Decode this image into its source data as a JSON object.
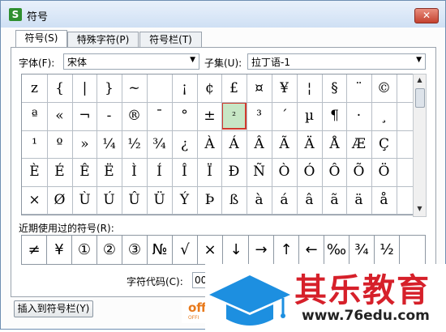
{
  "window": {
    "icon_letter": "S",
    "title": "符号",
    "close_glyph": "✕"
  },
  "tabs": [
    {
      "label": "符号(S)"
    },
    {
      "label": "特殊字符(P)"
    },
    {
      "label": "符号栏(T)"
    }
  ],
  "font": {
    "label": "字体(F):",
    "value": "宋体"
  },
  "subset": {
    "label": "子集(U):",
    "value": "拉丁语-1"
  },
  "symbols": [
    [
      "z",
      "{",
      "|",
      "}",
      "~",
      " ",
      "¡",
      "¢",
      "£",
      "¤",
      "¥",
      "¦",
      "§",
      "¨",
      "©"
    ],
    [
      "ª",
      "«",
      "¬",
      "-",
      "®",
      "¯",
      "°",
      "±",
      "²",
      "³",
      "´",
      "µ",
      "¶",
      "·",
      "¸"
    ],
    [
      "¹",
      "º",
      "»",
      "¼",
      "½",
      "¾",
      "¿",
      "À",
      "Á",
      "Â",
      "Ã",
      "Ä",
      "Å",
      "Æ",
      "Ç"
    ],
    [
      "È",
      "É",
      "Ê",
      "Ë",
      "Ì",
      "Í",
      "Î",
      "Ï",
      "Ð",
      "Ñ",
      "Ò",
      "Ó",
      "Ô",
      "Õ",
      "Ö"
    ],
    [
      "×",
      "Ø",
      "Ù",
      "Ú",
      "Û",
      "Ü",
      "Ý",
      "Þ",
      "ß",
      "à",
      "á",
      "â",
      "ã",
      "ä",
      "å"
    ]
  ],
  "selected_symbol": "²",
  "recent": {
    "label": "近期使用过的符号(R):",
    "items": [
      "≠",
      "¥",
      "①",
      "②",
      "③",
      "№",
      "√",
      "×",
      "↓",
      "→",
      "↑",
      "←",
      "‰",
      "¾",
      "½"
    ]
  },
  "char_code": {
    "label": "字符代码(C):",
    "value": "00"
  },
  "insert_button": "插入到符号栏(Y)",
  "watermark": {
    "cn": "其乐教育",
    "url": "www.76edu.com",
    "badge": "off",
    "badge_sub": "OFFI"
  }
}
